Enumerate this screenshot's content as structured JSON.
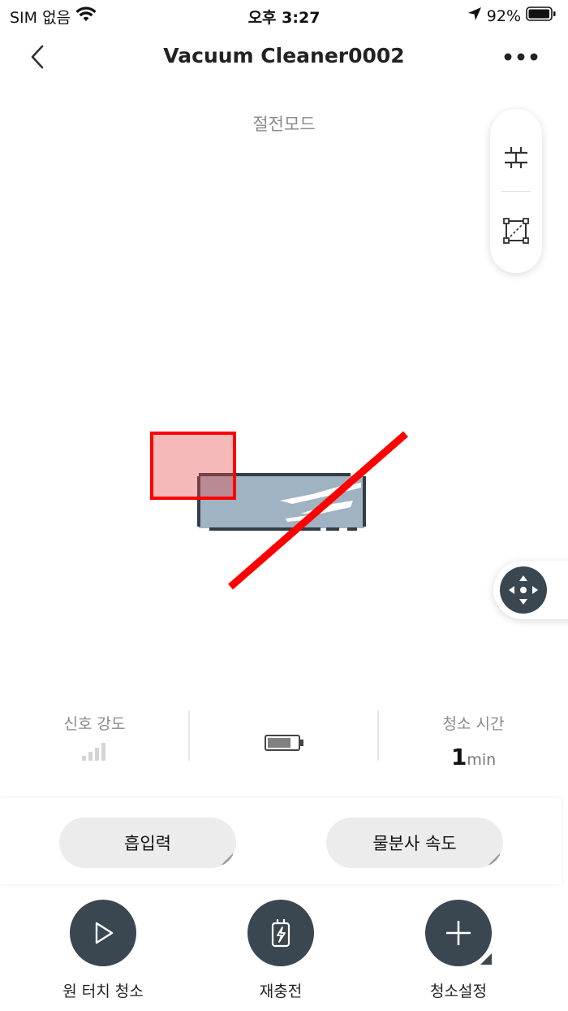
{
  "status_bar": {
    "carrier": "SIM 없음",
    "time": "오후 3:27",
    "battery": "92%"
  },
  "nav": {
    "title": "Vacuum Cleaner0002"
  },
  "device": {
    "mode": "절전모드"
  },
  "stats": {
    "signal_label": "신호 강도",
    "time_label": "청소 시간",
    "time_value": "1",
    "time_unit": "min"
  },
  "settings": {
    "suction_label": "흡입력",
    "water_label": "물분사 속도"
  },
  "actions": {
    "one_touch": "원 터치 청소",
    "recharge": "재충전",
    "clean_settings": "청소설정"
  },
  "colors": {
    "button_dark": "#3a4650",
    "map_fill": "#9fb3c3",
    "forbidden_red": "#ff0000"
  }
}
